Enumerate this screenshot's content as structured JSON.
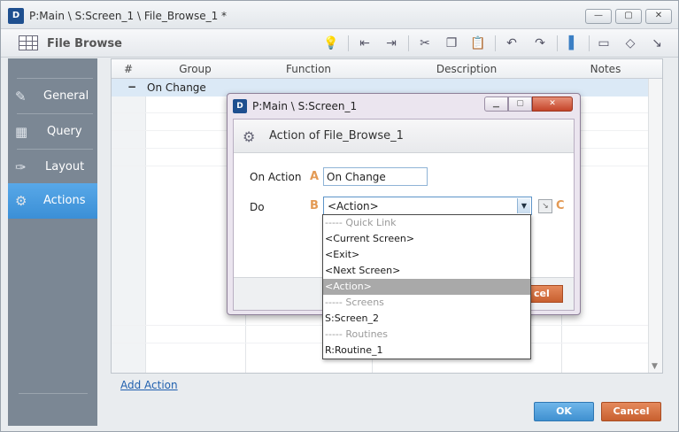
{
  "window": {
    "title": "P:Main \\ S:Screen_1 \\ File_Browse_1 *",
    "logo": "D",
    "buttons": [
      "—",
      "▢",
      "✕"
    ]
  },
  "toolbar": {
    "title": "File Browse",
    "icons": [
      "lightbulb-icon",
      "indent-left-icon",
      "indent-right-icon",
      "cut-icon",
      "copy-icon",
      "paste-icon",
      "undo-icon",
      "redo-icon",
      "comment-icon",
      "note-icon",
      "diamond-icon",
      "goto-icon"
    ],
    "glyphs": [
      "💡",
      "⇤",
      "⇥",
      "✂",
      "❐",
      "📋",
      "↶",
      "↷",
      "▌",
      "▭",
      "◇",
      "↘"
    ]
  },
  "sidebar": {
    "items": [
      {
        "label": "General",
        "icon": "✎"
      },
      {
        "label": "Query",
        "icon": "▦"
      },
      {
        "label": "Layout",
        "icon": "✑"
      },
      {
        "label": "Actions",
        "icon": "⚙"
      }
    ]
  },
  "grid": {
    "columns": [
      "#",
      "Group",
      "Function",
      "Description",
      "Notes"
    ],
    "group_row": {
      "toggle": "−",
      "label": "On Change"
    }
  },
  "footer": {
    "add_action": "Add Action",
    "ok": "OK",
    "cancel": "Cancel"
  },
  "dialog": {
    "title": "P:Main \\ S:Screen_1",
    "logo": "D",
    "header": "Action of File_Browse_1",
    "on_action_label": "On Action",
    "on_action_value": "On Change",
    "do_label": "Do",
    "do_value": "<Action>",
    "letters": {
      "a": "A",
      "b": "B",
      "c": "C"
    },
    "cancel_partial": "cel",
    "wbuttons": [
      "▁",
      "▢",
      "✕"
    ]
  },
  "dropdown": {
    "items": [
      {
        "text": "----- Quick Link",
        "type": "hdr"
      },
      {
        "text": "<Current Screen>",
        "type": "item"
      },
      {
        "text": "<Exit>",
        "type": "item"
      },
      {
        "text": "<Next Screen>",
        "type": "item"
      },
      {
        "text": "<Action>",
        "type": "sel"
      },
      {
        "text": "----- Screens",
        "type": "hdr"
      },
      {
        "text": "S:Screen_2",
        "type": "item"
      },
      {
        "text": "----- Routines",
        "type": "hdr"
      },
      {
        "text": "R:Routine_1",
        "type": "item"
      }
    ]
  }
}
